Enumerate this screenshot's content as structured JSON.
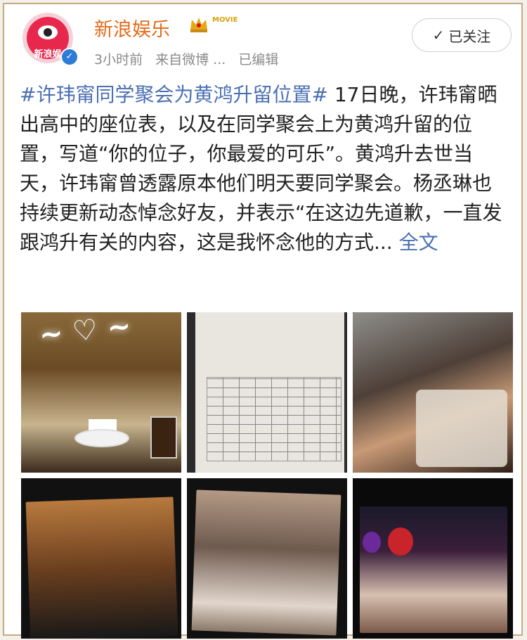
{
  "header": {
    "account_name": "新浪娱乐",
    "avatar_text": "新浪娱",
    "movie_badge": "MOVIE",
    "meta_time": "3小时前",
    "meta_source": "来自微博 ...",
    "meta_edited": "已编辑",
    "follow_label": "已关注",
    "follow_check": "✓"
  },
  "post": {
    "hashtag": "#许玮甯同学聚会为黄鸿升留位置#",
    "body": " 17日晚，许玮甯晒出高中的座位表，以及在同学聚会上为黄鸿升留的位置，写道“你的位子，你最爱的可乐”。黄鸿升去世当天，许玮甯曾透露原本他们明天要同学聚会。杨丞琳也持续更新动态悼念好友，并表示“在这边先道歉，一直发跟鸿升有关的内容，这是我怀念他的方式...",
    "more_label": " 全文"
  },
  "photos": [
    {
      "name": "photo-1"
    },
    {
      "name": "photo-2"
    },
    {
      "name": "photo-3"
    },
    {
      "name": "photo-4"
    },
    {
      "name": "photo-5"
    },
    {
      "name": "photo-6"
    }
  ],
  "colors": {
    "accent_name": "#e36b1a",
    "link": "#4a6fb3",
    "border": "#caa97e"
  }
}
